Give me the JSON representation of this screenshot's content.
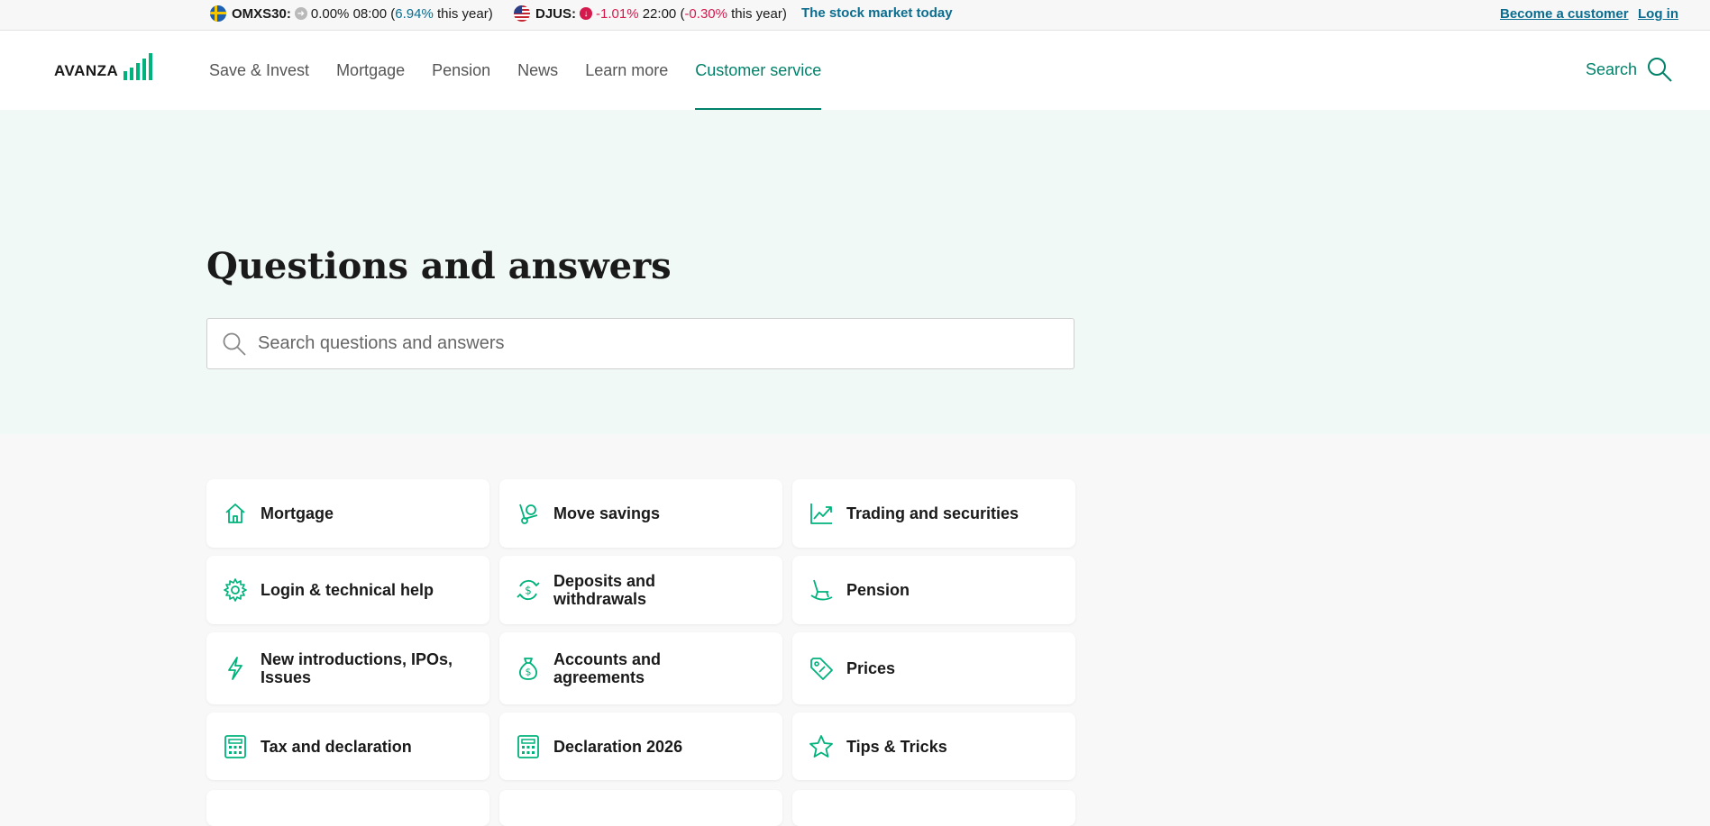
{
  "ticker": {
    "omx_label": "OMXS30:",
    "omx_change": "0.00%",
    "omx_time": "08:00",
    "omx_year_open": "(",
    "omx_year_value": "6.94%",
    "omx_year_text": " this year)",
    "djus_label": "DJUS:",
    "djus_change": "-1.01%",
    "djus_time": "22:00",
    "djus_year_open": "(",
    "djus_year_value": "-0.30%",
    "djus_year_text": " this year)",
    "market_link": "The stock market today",
    "become_customer": "Become a customer",
    "login": "Log in"
  },
  "header": {
    "logo_text": "AVANZA",
    "nav": [
      "Save & Invest",
      "Mortgage",
      "Pension",
      "News",
      "Learn more",
      "Customer service"
    ],
    "active_nav": "Customer service",
    "search_label": "Search"
  },
  "hero": {
    "title": "Questions and answers",
    "search_placeholder": "Search questions and answers"
  },
  "categories": [
    {
      "label": "Mortgage",
      "icon": "house-icon"
    },
    {
      "label": "Move savings",
      "icon": "dolly-icon"
    },
    {
      "label": "Trading and securities",
      "icon": "chart-up-icon"
    },
    {
      "label": "Login & technical help",
      "icon": "gear-icon"
    },
    {
      "label": "Deposits and withdrawals",
      "icon": "dollar-transfer-icon"
    },
    {
      "label": "Pension",
      "icon": "rocking-chair-icon"
    },
    {
      "label": "New introductions, IPOs, Issues",
      "icon": "lightning-icon"
    },
    {
      "label": "Accounts and agreements",
      "icon": "money-bag-icon"
    },
    {
      "label": "Prices",
      "icon": "price-tag-icon"
    },
    {
      "label": "Tax and declaration",
      "icon": "calculator-icon"
    },
    {
      "label": "Declaration 2026",
      "icon": "calculator-icon"
    },
    {
      "label": "Tips & Tricks",
      "icon": "star-icon"
    }
  ],
  "colors": {
    "accent": "#00826a",
    "brand_green": "#00b27b",
    "positive": "#0a6d8f",
    "negative": "#d51b4d",
    "hero_bg": "#f0f9f6"
  }
}
